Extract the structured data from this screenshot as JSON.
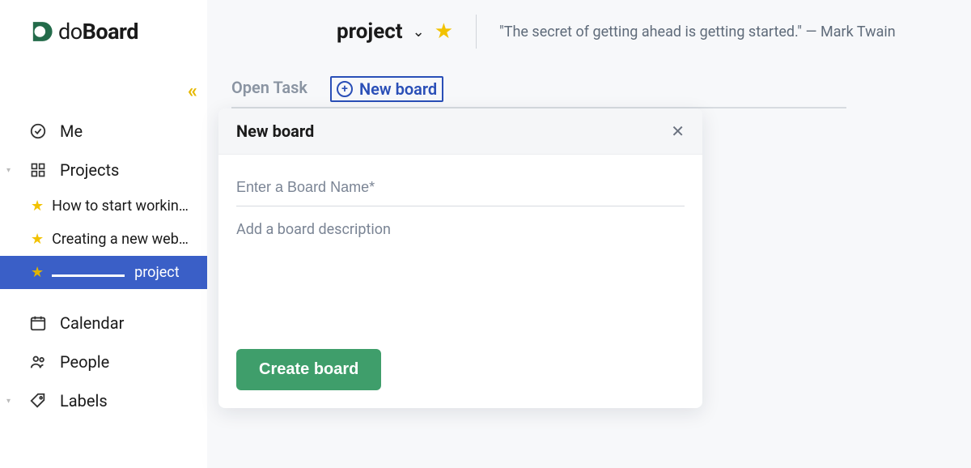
{
  "brand": {
    "do": "do",
    "board": "Board"
  },
  "sidebar": {
    "me": "Me",
    "projects": "Projects",
    "calendar": "Calendar",
    "people": "People",
    "labels": "Labels",
    "items": [
      {
        "label": "How to start workin…"
      },
      {
        "label": "Creating a new web…"
      },
      {
        "label": "project"
      }
    ]
  },
  "header": {
    "title": "project",
    "quote": "\"The secret of getting ahead is getting started.\" — Mark Twain"
  },
  "tabs": {
    "open": "Open Task",
    "new": "New board"
  },
  "modal": {
    "title": "New board",
    "name_placeholder": "Enter a Board Name*",
    "desc_placeholder": "Add a board description",
    "create": "Create board"
  }
}
